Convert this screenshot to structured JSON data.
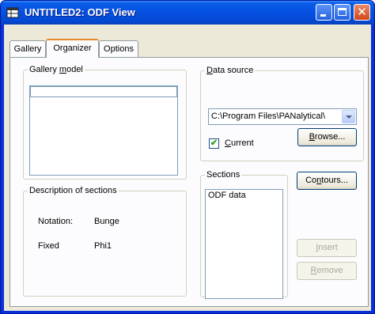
{
  "window": {
    "title": "UNTITLED2: ODF View",
    "close_glyph": "✕"
  },
  "tabs": [
    {
      "label": "Gallery"
    },
    {
      "label": "Organizer"
    },
    {
      "label": "Options"
    }
  ],
  "gallery_model": {
    "legend_pre": "Gallery ",
    "legend_accel": "m",
    "legend_post": "odel"
  },
  "description": {
    "legend": "Description of sections",
    "notation_label": "Notation:",
    "notation_value": "Bunge",
    "fixed_label": "Fixed",
    "fixed_value": "Phi1"
  },
  "data_source": {
    "legend_accel": "D",
    "legend_post": "ata source",
    "combo_value": "C:\\Program Files\\PANalytical\\",
    "current_accel": "C",
    "current_post": "urrent",
    "current_checked": true,
    "check_glyph": "✔",
    "browse_accel": "B",
    "browse_post": "rowse..."
  },
  "sections": {
    "legend": "Sections",
    "items": [
      "ODF data"
    ]
  },
  "buttons": {
    "contours_pre": "Co",
    "contours_accel": "n",
    "contours_post": "tours...",
    "insert_accel": "I",
    "insert_post": "nsert",
    "remove_accel": "R",
    "remove_post": "emove"
  }
}
